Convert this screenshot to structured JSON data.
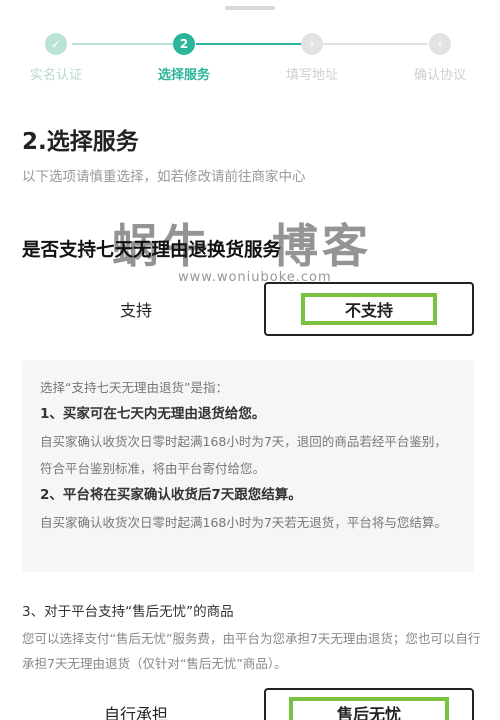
{
  "stepper": {
    "steps": [
      {
        "label": "实名认证",
        "state": "done"
      },
      {
        "label": "选择服务",
        "state": "active",
        "number": "2"
      },
      {
        "label": "填写地址",
        "state": "todo"
      },
      {
        "label": "确认协议",
        "state": "todo"
      }
    ],
    "colors": {
      "done": "#b9e3d7",
      "active": "#2bb59a",
      "todo": "#e3e3e3"
    }
  },
  "section": {
    "title": "2.选择服务",
    "hint": "以下选项请慎重选择，如若修改请前往商家中心"
  },
  "question": "是否支持七天无理由退换货服务",
  "watermark": {
    "text": "蜗牛 博客",
    "url": "www.woniuboke.com"
  },
  "options1": {
    "support": "支持",
    "not_support": "不支持"
  },
  "info": {
    "intro": "选择“支持七天无理由退货”是指：",
    "item1_title": "1、买家可在七天内无理由退货给您。",
    "item1_body": "自买家确认收货次日零时起满168小时为7天，退回的商品若经平台鉴别，符合平台鉴别标准，将由平台寄付给您。",
    "item2_title": "2、平台将在买家确认收货后7天跟您结算。",
    "item2_body": "自买家确认收货次日零时起满168小时为7天若无退货，平台将与您结算。"
  },
  "note": {
    "title": "3、对于平台支持“售后无忧”的商品",
    "body": "您可以选择支付“售后无忧”服务费，由平台为您承担7天无理由退货；您也可以自行承担7天无理由退货（仅针对“售后无忧”商品）。"
  },
  "options2": {
    "self": "自行承担",
    "worry_free": "售后无忧"
  }
}
